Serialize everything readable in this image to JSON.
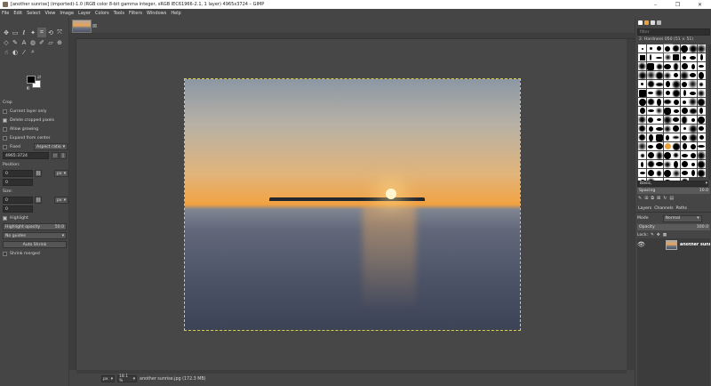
{
  "window": {
    "title": "[another sunrise] (imported)-1.0 (RGB color 8-bit gamma integer, sRGB IEC61966-2.1, 1 layer) 4965x3724 – GIMP",
    "minimize": "–",
    "maximize": "❐",
    "close": "✕"
  },
  "menu": [
    "File",
    "Edit",
    "Select",
    "View",
    "Image",
    "Layer",
    "Colors",
    "Tools",
    "Filters",
    "Windows",
    "Help"
  ],
  "tool_options": {
    "section_title": "Crop",
    "current_layer_only": "Current layer only",
    "delete_cropped": "Delete cropped pixels",
    "allow_growing": "Allow growing",
    "expand_from_center": "Expand from center",
    "fixed_label": "Fixed",
    "fixed_value": "Aspect ratio",
    "ratio_value": "4965:3724",
    "position_label": "Position:",
    "position_unit": "px",
    "position_x": "0",
    "position_y": "0",
    "size_label": "Size:",
    "size_unit": "px",
    "size_w": "0",
    "size_h": "0",
    "highlight": "Highlight",
    "highlight_opacity_label": "Highlight opacity",
    "highlight_opacity_value": "50.0",
    "guides": "No guides",
    "auto_shrink": "Auto Shrink",
    "shrink_merged": "Shrink merged"
  },
  "status": {
    "unit": "px",
    "zoom": "18.1 %",
    "text": "another sunrise.jpg (172.3 MB)"
  },
  "brushes": {
    "filter_placeholder": "filter",
    "current": "2. Hardness 050 (51 × 51)",
    "preset": "Basic,",
    "spacing_label": "Spacing",
    "spacing_value": "10.0"
  },
  "layers": {
    "tabs": [
      "Layers",
      "Channels",
      "Paths"
    ],
    "mode_label": "Mode",
    "mode_value": "Normal",
    "opacity_label": "Opacity",
    "opacity_value": "100.0",
    "lock_label": "Lock:",
    "items": [
      {
        "name": "another sunrise"
      }
    ]
  }
}
